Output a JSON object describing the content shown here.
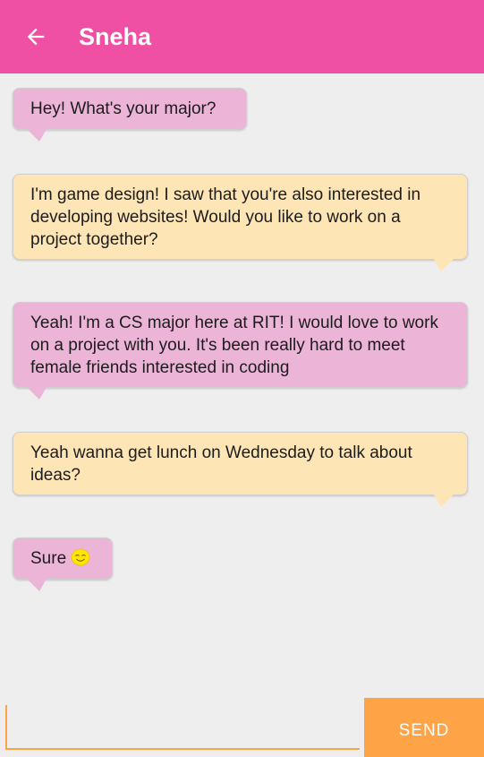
{
  "header": {
    "title": "Sneha",
    "back_icon": "arrow-left-icon",
    "background": "#f050a4"
  },
  "messages": [
    {
      "direction": "incoming",
      "text": "Hey! What's your major?"
    },
    {
      "direction": "outgoing",
      "text": "I'm game design! I saw that you're also interested in developing websites! Would you like to work on a project together?"
    },
    {
      "direction": "incoming",
      "text": "Yeah! I'm a CS major here at RIT! I would love to work on a project with you. It's been really hard to meet female friends interested in coding"
    },
    {
      "direction": "outgoing",
      "text": "Yeah wanna get lunch on Wednesday to talk about ideas?"
    },
    {
      "direction": "incoming",
      "text": "Sure",
      "emoji": "smiling-face-icon"
    }
  ],
  "composer": {
    "input_value": "",
    "input_placeholder": "",
    "send_label": "SEND"
  },
  "colors": {
    "incoming_bubble": "#ecb4d7",
    "outgoing_bubble": "#fde5b6",
    "accent": "#ffa347",
    "background": "#eeeeee"
  }
}
